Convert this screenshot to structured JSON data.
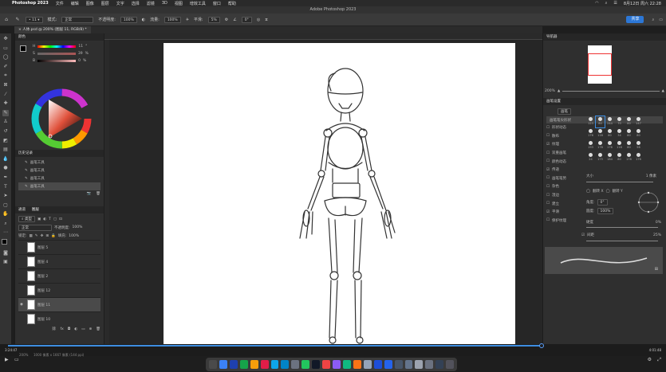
{
  "menubar": {
    "app": "Photoshop 2023",
    "items": [
      "文件",
      "编辑",
      "图像",
      "图层",
      "文字",
      "选择",
      "滤镜",
      "3D",
      "视图",
      "增效工具",
      "窗口",
      "帮助"
    ],
    "clock": "8月12日 周六 22:28"
  },
  "window_title": "Adobe Photoshop 2023",
  "options": {
    "mode_label": "模式:",
    "mode_value": "正常",
    "opacity_label": "不透明度:",
    "opacity_value": "100%",
    "flow_label": "流量:",
    "flow_value": "100%",
    "smooth_label": "平滑:",
    "smooth_value": "5%",
    "angle_value": "0°",
    "share": "共享"
  },
  "doc_tab": "人体.psd @ 200% (图层 11, RGB/8) *",
  "color_panel": {
    "title": "颜色",
    "sliders": [
      {
        "label": "H",
        "value": "11"
      },
      {
        "label": "S",
        "value": "39"
      },
      {
        "label": "B",
        "value": "0"
      }
    ],
    "units": [
      "°",
      "%",
      "%"
    ]
  },
  "history_panel": {
    "title": "历史记录",
    "items": [
      "画笔工具",
      "画笔工具",
      "画笔工具",
      "画笔工具"
    ]
  },
  "layers_panel": {
    "tabs": [
      "通道",
      "图层"
    ],
    "filter": "类型",
    "blend_mode": "正常",
    "opacity_label": "不透明度:",
    "opacity_value": "100%",
    "lock_label": "锁定:",
    "fill_label": "填充:",
    "fill_value": "100%",
    "layers": [
      "图层 5",
      "图层 4",
      "图层 2",
      "图层 12",
      "图层 11",
      "图层 10"
    ],
    "selected": 4
  },
  "navigator": {
    "title": "导航器",
    "zoom": "200%"
  },
  "brush_settings": {
    "title": "画笔设置",
    "brushes_btn": "画笔",
    "tip_shape": "画笔笔尖形状",
    "options": [
      {
        "label": "形状动态",
        "checked": false
      },
      {
        "label": "散布",
        "checked": false
      },
      {
        "label": "纹理",
        "checked": true
      },
      {
        "label": "双重画笔",
        "checked": false
      },
      {
        "label": "颜色动态",
        "checked": false
      },
      {
        "label": "传递",
        "checked": true
      },
      {
        "label": "画笔笔势",
        "checked": false
      },
      {
        "label": "杂色",
        "checked": false
      },
      {
        "label": "湿边",
        "checked": false
      },
      {
        "label": "建立",
        "checked": false
      },
      {
        "label": "平滑",
        "checked": true
      },
      {
        "label": "保护纹理",
        "checked": false
      }
    ],
    "brush_sizes": [
      "123",
      "80",
      "244",
      "70",
      "80",
      "147",
      "176",
      "116",
      "80",
      "34",
      "80",
      "80",
      "193",
      "176",
      "176",
      "116",
      "80",
      "56",
      "24",
      "175",
      "184",
      "80",
      "178",
      "176"
    ],
    "size_label": "大小",
    "size_value": "1 像素",
    "flip_x": "翻转 X",
    "flip_y": "翻转 Y",
    "angle_label": "角度:",
    "angle_value": "0°",
    "roundness_label": "圆度:",
    "roundness_value": "100%",
    "hardness_label": "硬度",
    "hardness_value": "0%",
    "spacing_label": "间距",
    "spacing_value": "25%"
  },
  "video": {
    "time_start": "3:24:47",
    "time_end": "4:01:48",
    "progress": 0.9985
  },
  "status": {
    "zoom": "200%",
    "doc": "1000 像素 x 1667 像素 (144 ppi)"
  }
}
